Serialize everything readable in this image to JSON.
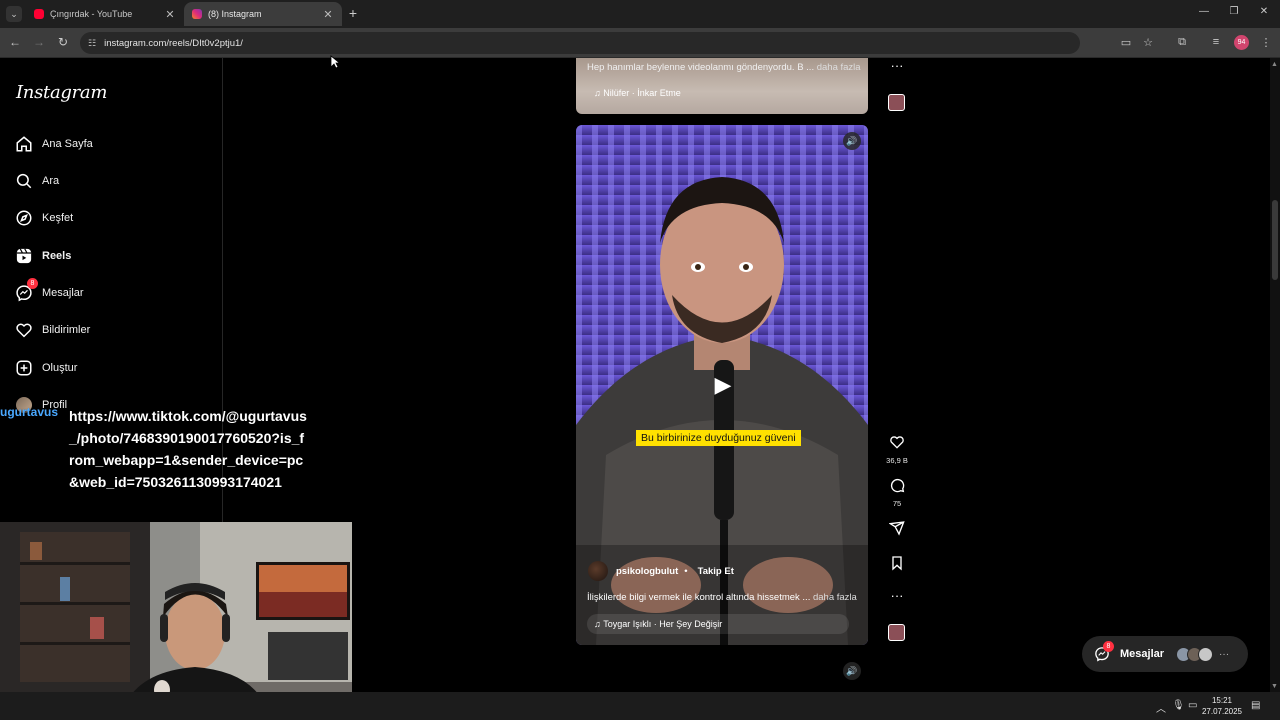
{
  "browser": {
    "tabs": [
      {
        "title": "Çıngırdak - YouTube",
        "favicon_color": "#ff0033",
        "active": false
      },
      {
        "title": "(8) Instagram",
        "favicon_color": "#d6249f",
        "active": true
      }
    ],
    "url": "instagram.com/reels/DIt0v2ptju1/",
    "profile_badge": "94"
  },
  "instagram": {
    "logo": "Instagram",
    "nav": [
      {
        "label": "Ana Sayfa",
        "icon": "home-icon"
      },
      {
        "label": "Ara",
        "icon": "search-icon"
      },
      {
        "label": "Keşfet",
        "icon": "compass-icon"
      },
      {
        "label": "Reels",
        "icon": "reels-icon"
      },
      {
        "label": "Mesajlar",
        "icon": "messenger-icon",
        "badge": "8"
      },
      {
        "label": "Bildirimler",
        "icon": "heart-icon"
      },
      {
        "label": "Oluştur",
        "icon": "plus-square-icon"
      },
      {
        "label": "Profil",
        "icon": "avatar"
      }
    ],
    "prev_reel": {
      "caption": "Hep hanımlar beylenne videolanmı göndenyordu. B ...",
      "more": "daha fazla",
      "audio": "Nilüfer · İnkar Etme"
    },
    "reel": {
      "subtitle": "Bu birbirinize duyduğunuz güveni",
      "author": "psikologbulut",
      "follow": "Takip Et",
      "caption": "İlişkilerde bilgi vermek ile kontrol altında hissetmek ...",
      "more": "daha fazla",
      "audio": "Toygar Işıklı · Her Şey Değişir",
      "likes": "36,9 B",
      "comments": "75"
    },
    "messages_float": {
      "label": "Mesajlar",
      "badge": "8"
    }
  },
  "overlay": {
    "username": "ugurtavus",
    "link": "https://www.tiktok.com/@ugurtavus_/photo/7468390190017760520?is_from_webapp=1&sender_device=pc&web_id=7503261130993174021"
  },
  "taskbar": {
    "time": "15:21",
    "date": "27.07.2025"
  }
}
